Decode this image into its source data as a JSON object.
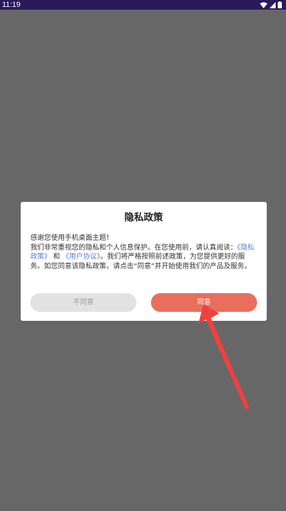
{
  "status_bar": {
    "time": "11:19",
    "icons": [
      "wifi-icon",
      "signal-icon",
      "battery-icon"
    ]
  },
  "dialog": {
    "title": "隐私政策",
    "line1": "感谢您使用手机桌面主题！",
    "line2_prefix": "我们非常重视您的隐私和个人信息保护。在您使用前，请认真阅读：",
    "privacy_link": "《隐私政策》",
    "and_text": " 和 ",
    "terms_link": "《用户协议》",
    "line2_suffix": "。我们将严格按照前述政策，为您提供更好的服务。如您同意该隐私政策，请点击“同意”并开始使用我们的产品及服务。",
    "disagree_label": "不同意",
    "agree_label": "同意"
  },
  "colors": {
    "backdrop": "#676767",
    "status_bar": "#2a1a5a",
    "agree_button": "#e96e5c",
    "disagree_button": "#e2e2e2",
    "link": "#5a7fd6",
    "annotation_arrow": "#f04040"
  }
}
